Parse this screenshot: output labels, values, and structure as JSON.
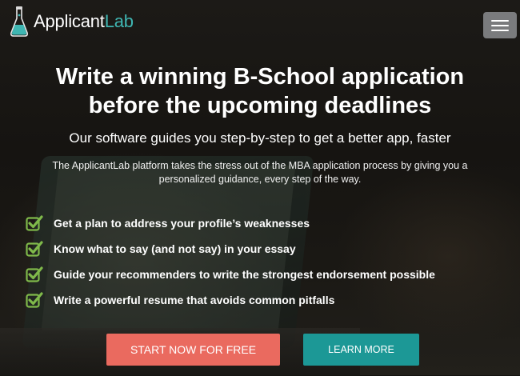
{
  "header": {
    "logo_part1": "Applicant",
    "logo_part2": "Lab",
    "menu_icon": "hamburger-menu-icon"
  },
  "hero": {
    "headline_line1": "Write a winning B-School application",
    "headline_line2": "before the upcoming deadlines",
    "subheadline": "Our software guides you step-by-step to get a better app, faster",
    "description": "The ApplicantLab platform takes the stress out of the MBA application process by giving you a personalized guidance, every step of the way."
  },
  "features": [
    "Get a plan to address your profile’s weaknesses",
    "Know what to say (and not say) in your essay",
    "Guide your recommenders to write the strongest endorsement possible",
    "Write a powerful resume that avoids common pitfalls"
  ],
  "buttons": {
    "start": "START NOW FOR FREE",
    "learn": "LEARN MORE"
  },
  "colors": {
    "brand_teal": "#3fb6b2",
    "check_green": "#7fb94a",
    "start_button": "#ea6a5f",
    "learn_button": "#1c9896"
  }
}
